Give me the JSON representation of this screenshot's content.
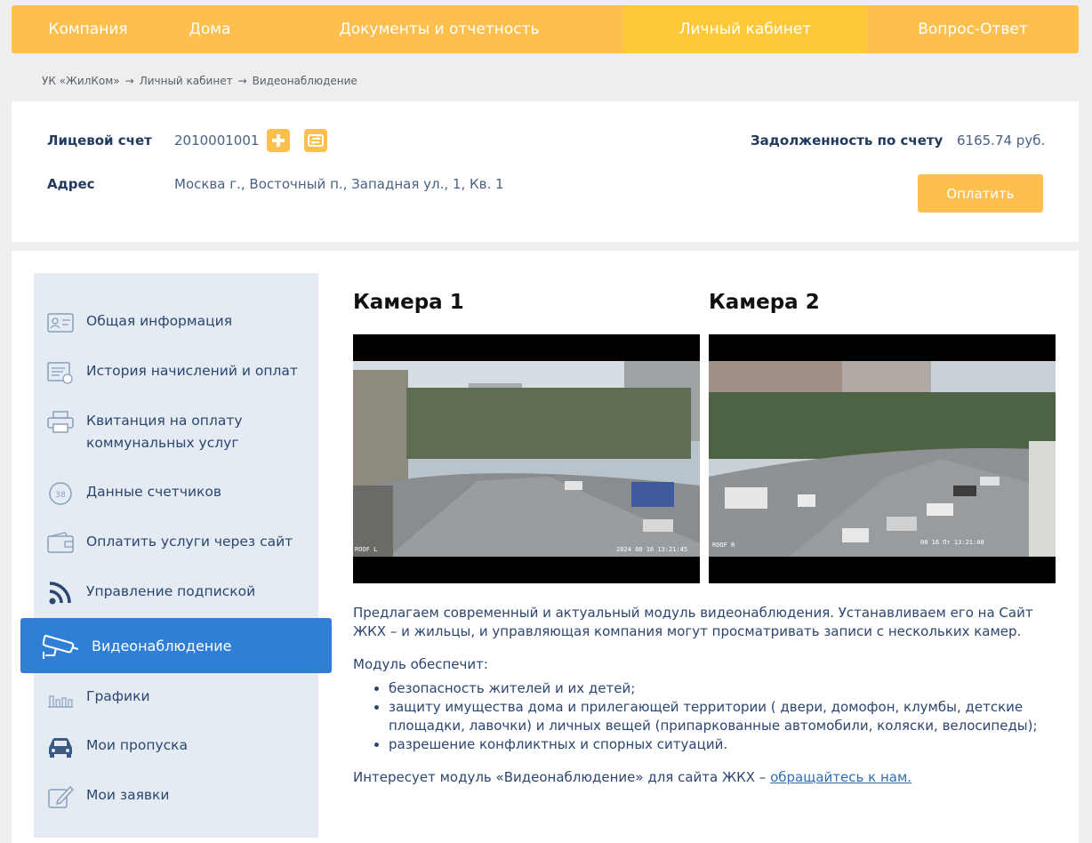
{
  "nav": [
    {
      "label": "Компания"
    },
    {
      "label": "Дома"
    },
    {
      "label": "Документы и отчетность"
    },
    {
      "label": "Личный кабинет"
    },
    {
      "label": "Вопрос-Ответ"
    }
  ],
  "breadcrumb": {
    "items": [
      "УК «ЖилКом»",
      "Личный кабинет",
      "Видеонаблюдение"
    ],
    "separator": "→"
  },
  "account": {
    "account_label": "Лицевой счет",
    "account_number": "2010001001",
    "address_label": "Адрес",
    "address": "Москва г., Восточный п., Западная ул., 1, Кв. 1",
    "debt_label": "Задолженность по счету",
    "debt_value": "6165.74 руб.",
    "pay_label": "Оплатить"
  },
  "sidebar": {
    "items": [
      {
        "label": "Общая информация",
        "icon": "id-card-icon"
      },
      {
        "label": "История начислений и оплат",
        "icon": "history-icon"
      },
      {
        "label": "Квитанция на оплату коммунальных услуг",
        "icon": "printer-icon"
      },
      {
        "label": "Данные счетчиков",
        "icon": "meter-icon"
      },
      {
        "label": "Оплатить услуги через сайт",
        "icon": "wallet-icon"
      },
      {
        "label": "Управление подпиской",
        "icon": "rss-icon"
      },
      {
        "label": "Видеонаблюдение",
        "icon": "camera-icon"
      },
      {
        "label": "Графики",
        "icon": "bar-chart-icon"
      },
      {
        "label": "Мои пропуска",
        "icon": "car-icon"
      },
      {
        "label": "Мои заявки",
        "icon": "edit-icon"
      }
    ]
  },
  "cameras": [
    {
      "title": "Камера 1",
      "overlay_left": "ROOF L",
      "overlay_right": "2024 08 16 13:21:45"
    },
    {
      "title": "Камера 2",
      "overlay_left": "ROOF R",
      "overlay_right": "08 16 Пт 13:21:00"
    }
  ],
  "text": {
    "intro": "Предлагаем современный и актуальный модуль видеонаблюдения. Устанавливаем его на Сайт ЖКХ – и жильцы, и управляющая компания могут просматривать записи с нескольких камер.",
    "provides": "Модуль обеспечит:",
    "list": [
      "безопасность жителей и их детей;",
      "защиту имущества дома и прилегающей территории ( двери, домофон, клумбы, детские площадки, лавочки) и личных вещей (припаркованные автомобили, коляски, велосипеды);",
      "разрешение конфликтных и спорных ситуаций."
    ],
    "outro": "Интересует модуль «Видеонаблюдение» для сайта ЖКХ – ",
    "link": "обращайтесь к нам."
  },
  "colors": {
    "nav_bg": "#fdbf4e",
    "accent": "#2f7fd6",
    "sidebar_bg": "#e4ebf3",
    "text": "#2c4670"
  }
}
